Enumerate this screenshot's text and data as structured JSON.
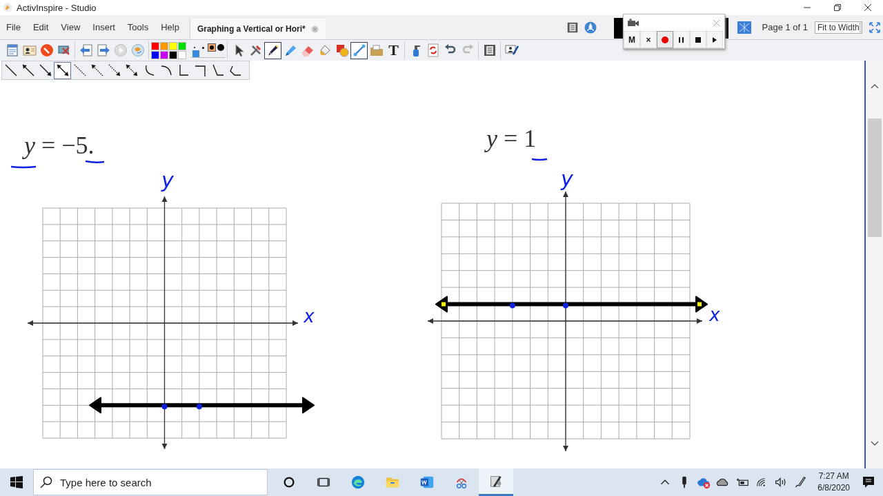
{
  "window": {
    "title": "ActivInspire - Studio"
  },
  "menu": [
    "File",
    "Edit",
    "View",
    "Insert",
    "Tools",
    "Help"
  ],
  "document_tab": {
    "label": "Graphing a Vertical or Hori*",
    "selected": true
  },
  "top_tools": [
    {
      "kind": "pageview"
    },
    {
      "kind": "rocket"
    }
  ],
  "recorder": {
    "buttons": [
      {
        "kind": "text",
        "label": "M",
        "selected": false
      },
      {
        "kind": "text",
        "label": "×",
        "selected": false
      },
      {
        "kind": "record",
        "selected": true
      },
      {
        "kind": "pause",
        "selected": false
      },
      {
        "kind": "stop",
        "selected": false
      },
      {
        "kind": "play",
        "selected": false
      }
    ]
  },
  "page_indicator": "Page 1 of 1",
  "zoom_select": {
    "value": "Fit to Width"
  },
  "palette": [
    {
      "color": "#ff0000"
    },
    {
      "color": "#ff9900"
    },
    {
      "color": "#ffff00"
    },
    {
      "color": "#00dd00"
    },
    {
      "color": "#0000ff"
    },
    {
      "color": "#cc00ff"
    },
    {
      "color": "#000000"
    },
    {
      "color": "#ffffff"
    }
  ],
  "pen_sizes": [
    {
      "selected": false
    },
    {
      "selected": false
    },
    {
      "selected": true
    },
    {
      "selected": false
    }
  ],
  "pen_width": {
    "level": 0.05
  },
  "toolbar": [
    [
      {
        "kind": "browsers",
        "selected": false
      },
      {
        "kind": "profiles",
        "selected": false
      },
      {
        "kind": "annotate",
        "selected": false
      },
      {
        "kind": "desktop",
        "selected": false
      }
    ],
    [
      {
        "kind": "prev",
        "selected": false
      },
      {
        "kind": "next",
        "selected": false
      },
      {
        "kind": "play",
        "selected": false
      },
      {
        "kind": "globe",
        "selected": false
      }
    ],
    [
      {
        "kind": "palette"
      }
    ],
    [
      {
        "kind": "select",
        "selected": false
      },
      {
        "kind": "tools",
        "selected": false
      },
      {
        "kind": "pen",
        "selected": true
      },
      {
        "kind": "highlighter",
        "selected": false
      },
      {
        "kind": "eraser",
        "selected": false
      },
      {
        "kind": "fill",
        "selected": false
      },
      {
        "kind": "shape",
        "selected": false
      },
      {
        "kind": "line",
        "selected": true
      },
      {
        "kind": "folder",
        "selected": false
      },
      {
        "kind": "text",
        "label": "T",
        "selected": false
      }
    ],
    [
      {
        "kind": "clear",
        "selected": false
      },
      {
        "kind": "reset",
        "selected": false
      },
      {
        "kind": "undo",
        "selected": false
      },
      {
        "kind": "redo",
        "selected": false
      }
    ],
    [
      {
        "kind": "pageview",
        "selected": false
      }
    ],
    [
      {
        "kind": "userpen",
        "selected": false
      }
    ]
  ],
  "line_styles": [
    {
      "kind": "solid-none",
      "selected": false
    },
    {
      "kind": "solid-start",
      "selected": false
    },
    {
      "kind": "solid-end",
      "selected": false
    },
    {
      "kind": "solid-both",
      "selected": true
    },
    {
      "kind": "dotted-none",
      "selected": false
    },
    {
      "kind": "dotted-start",
      "selected": false
    },
    {
      "kind": "dotted-end",
      "selected": false
    },
    {
      "kind": "dotted-both",
      "selected": false
    },
    {
      "kind": "curve-a",
      "selected": false
    },
    {
      "kind": "curve-b",
      "selected": false
    },
    {
      "kind": "step-a",
      "selected": false
    },
    {
      "kind": "step-b",
      "selected": false
    },
    {
      "kind": "angle-a",
      "selected": false
    },
    {
      "kind": "angle-b",
      "selected": false
    }
  ],
  "canvas": {
    "graphs": [
      {
        "equation": "*y* = −5.",
        "y_label": "y",
        "x_label": "x",
        "endpoints_highlighted": false
      },
      {
        "equation": "*y* = 1",
        "y_label": "y",
        "x_label": "x",
        "endpoints_highlighted": true
      }
    ]
  },
  "taskbar": {
    "search": {
      "placeholder": "Type here to search"
    },
    "apps": [
      {
        "kind": "cortana",
        "selected": false
      },
      {
        "kind": "taskview",
        "selected": false
      },
      {
        "kind": "edge",
        "selected": false
      },
      {
        "kind": "explorer",
        "selected": false
      },
      {
        "kind": "word",
        "selected": false
      },
      {
        "kind": "snip",
        "selected": false
      },
      {
        "kind": "activinspire",
        "selected": true
      }
    ],
    "tray": [
      {
        "kind": "chevron"
      },
      {
        "kind": "mic"
      },
      {
        "kind": "onedrive-error"
      },
      {
        "kind": "cloud"
      },
      {
        "kind": "battery"
      },
      {
        "kind": "wifi"
      },
      {
        "kind": "volume"
      },
      {
        "kind": "pen"
      }
    ],
    "time": "7:27 AM",
    "date": "6/8/2020"
  }
}
